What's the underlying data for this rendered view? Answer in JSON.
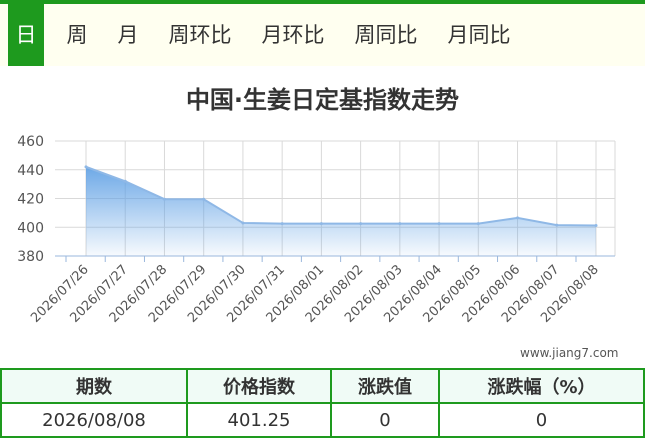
{
  "tabs": [
    {
      "label": "日",
      "active": true
    },
    {
      "label": "周",
      "active": false
    },
    {
      "label": "月",
      "active": false
    },
    {
      "label": "周环比",
      "active": false
    },
    {
      "label": "月环比",
      "active": false
    },
    {
      "label": "周同比",
      "active": false
    },
    {
      "label": "月同比",
      "active": false
    }
  ],
  "colors": {
    "accent": "#1e9a1e",
    "series_line": "#8fb8e6",
    "series_fill": "#5d9fe4"
  },
  "watermark": "www.jiang7.com",
  "chart_data": {
    "type": "area",
    "title": "中国·生姜日定基指数走势",
    "xlabel": "",
    "ylabel": "",
    "ylim": [
      380,
      460
    ],
    "yticks": [
      380,
      400,
      420,
      440,
      460
    ],
    "grid": true,
    "legend": "none",
    "categories": [
      "2026/07/26",
      "2026/07/27",
      "2026/07/28",
      "2026/07/29",
      "2026/07/30",
      "2026/07/31",
      "2026/08/01",
      "2026/08/02",
      "2026/08/03",
      "2026/08/04",
      "2026/08/05",
      "2026/08/06",
      "2026/08/07",
      "2026/08/08"
    ],
    "series": [
      {
        "values": [
          442,
          432,
          419.5,
          419.5,
          403,
          402.5,
          402.5,
          402.5,
          402.5,
          402.5,
          402.5,
          406.5,
          401.5,
          401.25
        ]
      }
    ]
  },
  "table": {
    "headers": [
      "期数",
      "价格指数",
      "涨跌值",
      "涨跌幅（%）"
    ],
    "row": [
      "2026/08/08",
      "401.25",
      "0",
      "0"
    ]
  }
}
